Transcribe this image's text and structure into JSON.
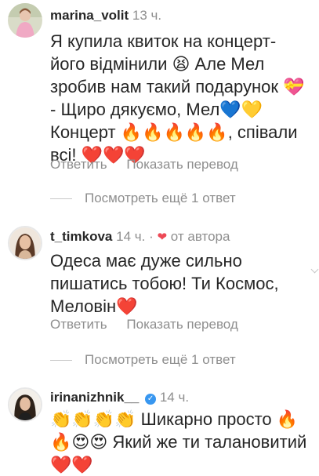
{
  "comments": [
    {
      "username": "marina_volit",
      "time": "13 ч.",
      "text": "Я купила квиток на концерт- його відмінили 😫 Але Мел зробив нам такий подарунок 💝 - Щиро дякуємо, Мел💙💛 Концерт 🔥🔥🔥🔥🔥, співали всі! ❤️❤️❤️",
      "reply_label": "Ответить",
      "translate_label": "Показать перевод",
      "more_replies": "Посмотреть ещё 1 ответ"
    },
    {
      "username": "t_timkova",
      "time": "14 ч.",
      "dot": "·",
      "author_heart": "❤",
      "author_label": "от автора",
      "text": "Одеса має дуже сильно пишатись тобою! Ти Космос, Меловін❤️",
      "reply_label": "Ответить",
      "translate_label": "Показать перевод",
      "more_replies": "Посмотреть ещё 1 ответ"
    },
    {
      "username": "irinanizhnik__",
      "verified_mark": "✓",
      "time": "14 ч.",
      "text": "👏👏👏👏 Шикарно просто 🔥🔥😍😍 Який же ти талановитий ❤️❤️"
    }
  ],
  "colors": {
    "text": "#262626",
    "meta": "#8e8e8e",
    "heart": "#ed4956",
    "verified": "#3897f0"
  }
}
